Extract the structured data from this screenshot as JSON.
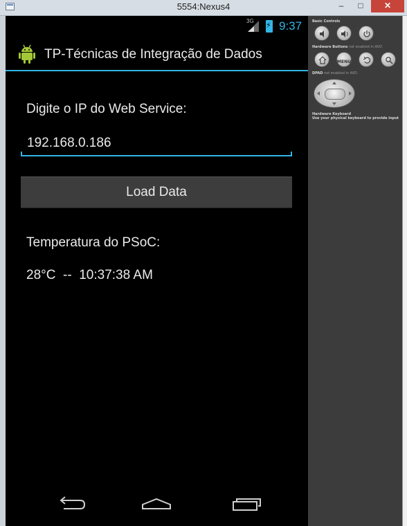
{
  "window": {
    "title": "5554:Nexus4",
    "minimize_label": "–",
    "maximize_label": "□",
    "close_label": "✕"
  },
  "status_bar": {
    "network": "3G",
    "time": "9:37"
  },
  "app": {
    "title": "TP-Técnicas de Integração de Dados"
  },
  "form": {
    "ip_label": "Digite o IP do Web Service:",
    "ip_value": "192.168.0.186",
    "load_button": "Load Data",
    "temp_label": "Temperatura do PSoC:",
    "temp_reading": "28°C  --  10:37:38 AM"
  },
  "controls_panel": {
    "basic_controls": "Basic Controls",
    "hardware_buttons": "Hardware Buttons",
    "hardware_buttons_note": "not enabled in AVD",
    "menu_label": "MENU",
    "dpad": "DPAD",
    "dpad_note": "not enabled in AVD",
    "keyboard_title": "Hardware Keyboard",
    "keyboard_note": "Use your physical keyboard to provide input"
  },
  "colors": {
    "accent": "#33b5e5",
    "screen_bg": "#000000",
    "panel_bg": "#3c3c3c"
  }
}
